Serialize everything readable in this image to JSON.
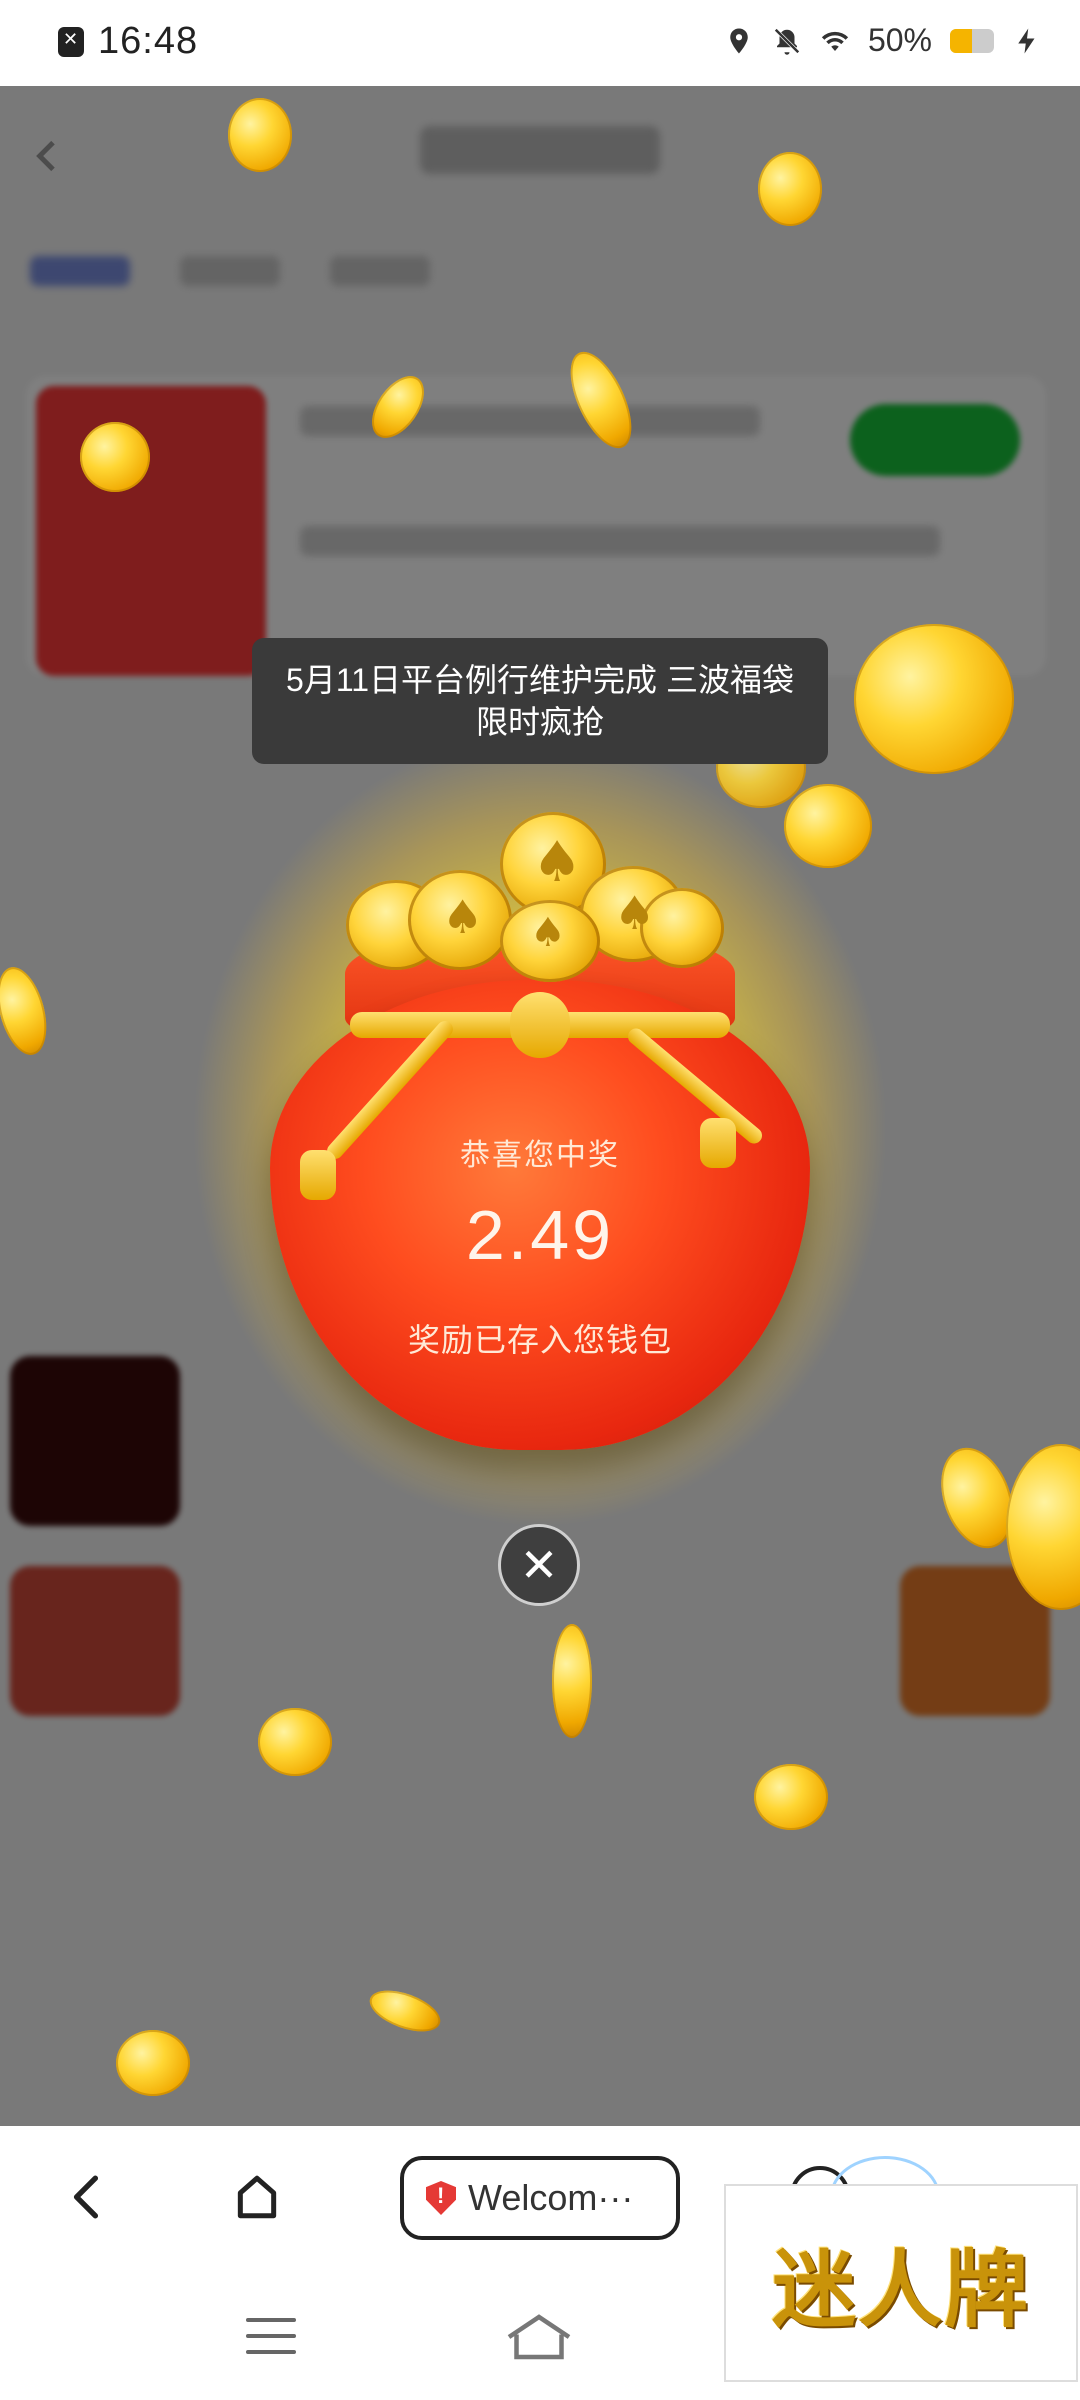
{
  "status_bar": {
    "time": "16:48",
    "battery_percent": "50%",
    "battery_level": 0.5,
    "icons": [
      "app-notification-icon",
      "location-icon",
      "mute-icon",
      "wifi-icon",
      "battery-icon",
      "charging-icon"
    ]
  },
  "toast": {
    "message": "5月11日平台例行维护完成 三波福袋 限时疯抢"
  },
  "prize": {
    "congrats": "恭喜您中奖",
    "amount": "2.49",
    "stored": "奖励已存入您钱包"
  },
  "browser": {
    "url_label": "Welcom···",
    "accent": "#e53935"
  },
  "watermark": {
    "text": "迷人牌"
  },
  "colors": {
    "bag_red": "#e8270f",
    "gold": "#ffd633",
    "overlay": "rgba(0,0,0,0.5)",
    "toast_bg": "#3a3a3a"
  }
}
